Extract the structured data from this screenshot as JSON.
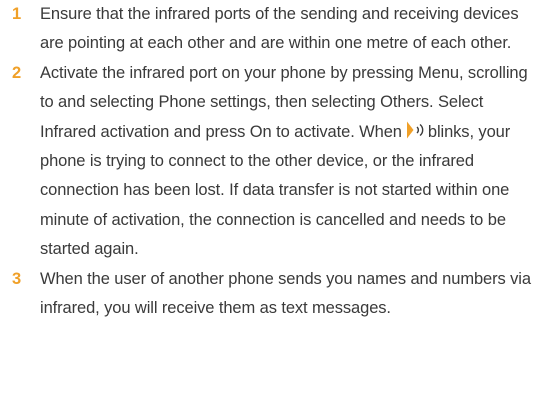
{
  "steps": [
    {
      "number": "1",
      "text": "Ensure that the infrared ports of the sending and receiving devices are pointing at each other and are within one metre of each other."
    },
    {
      "number": "2",
      "text_before_icon": "Activate the infrared port on your phone by pressing Menu, scrolling to and selecting Phone settings, then selecting Others. Select Infrared activation and press On to activate. When",
      "icon": "infrared-icon",
      "text_after_icon": "blinks, your phone is trying to connect to the other device, or the infrared connection has been lost. If data transfer is not started within one minute of activation, the connection is cancelled and needs to be started again."
    },
    {
      "number": "3",
      "text": "When the user of another phone sends you names and numbers via infrared, you will receive them as text messages."
    }
  ],
  "colors": {
    "step_number": "#f0a028",
    "body_text": "#3a3a3a",
    "icon_fill": "#f0a028"
  }
}
